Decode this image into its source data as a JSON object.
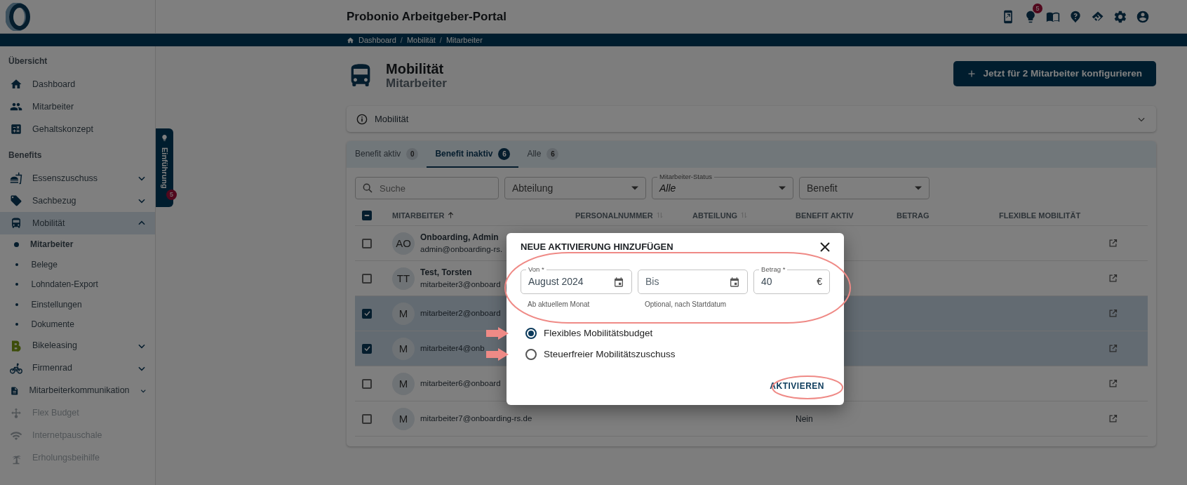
{
  "header": {
    "title": "Probonio Arbeitgeber-Portal",
    "notification_count": "5"
  },
  "breadcrumb": [
    {
      "kind": "link",
      "text": "Dashboard"
    },
    {
      "kind": "separator",
      "text": "/"
    },
    {
      "kind": "link",
      "text": "Mobilität"
    },
    {
      "kind": "separator",
      "text": "/"
    },
    {
      "kind": "link",
      "text": "Mitarbeiter"
    }
  ],
  "sidebar": {
    "sections": [
      {
        "title": "Übersicht",
        "items": [
          {
            "label": "Dashboard",
            "selected": false,
            "disabled": false
          },
          {
            "label": "Mitarbeiter",
            "selected": false,
            "disabled": false
          },
          {
            "label": "Gehaltskonzept",
            "selected": false,
            "disabled": false
          }
        ]
      },
      {
        "title": "Benefits",
        "items": [
          {
            "label": "Essenszuschuss",
            "selected": false,
            "disabled": false,
            "expanded": false
          },
          {
            "label": "Sachbezug",
            "selected": false,
            "disabled": false,
            "expanded": false
          },
          {
            "label": "Mobilität",
            "selected": true,
            "disabled": false,
            "expanded": true,
            "children": [
              {
                "label": "Mitarbeiter",
                "selected": true
              },
              {
                "label": "Belege",
                "selected": false
              },
              {
                "label": "Lohndaten-Export",
                "selected": false
              },
              {
                "label": "Einstellungen",
                "selected": false
              },
              {
                "label": "Dokumente",
                "selected": false
              }
            ]
          },
          {
            "label": "Bikeleasing",
            "selected": false,
            "disabled": false,
            "expanded": false
          },
          {
            "label": "Firmenrad",
            "selected": false,
            "disabled": false,
            "expanded": false
          },
          {
            "label": "Mitarbeiterkommunikation",
            "selected": false,
            "disabled": false,
            "expanded": false
          },
          {
            "label": "Flex Budget",
            "selected": false,
            "disabled": true
          },
          {
            "label": "Internetpauschale",
            "selected": false,
            "disabled": true
          },
          {
            "label": "Erholungsbeihilfe",
            "selected": false,
            "disabled": true
          }
        ]
      }
    ]
  },
  "intro_tab": {
    "label": "Einführung",
    "badge": "5"
  },
  "page": {
    "title": "Mobilität",
    "subtitle": "Mitarbeiter",
    "action_button": "Jetzt für 2 Mitarbeiter konfigurieren"
  },
  "accordion": {
    "title": "Mobilität",
    "expanded": false
  },
  "tabs": [
    {
      "label": "Benefit aktiv",
      "count": "0",
      "selected": false
    },
    {
      "label": "Benefit inaktiv",
      "count": "6",
      "selected": true
    },
    {
      "label": "Alle",
      "count": "6",
      "selected": false
    }
  ],
  "filters": [
    {
      "kind": "search",
      "placeholder": "Suche"
    },
    {
      "kind": "select",
      "placeholder": "Abteilung"
    },
    {
      "kind": "select",
      "label": "Mitarbeiter-Status",
      "value": "Alle"
    },
    {
      "kind": "select",
      "placeholder": "Benefit"
    }
  ],
  "table": {
    "header_checkbox": {
      "indeterminate": true
    },
    "columns": [
      {
        "label": "MITARBEITER",
        "sortable": true,
        "sorted": true
      },
      {
        "label": "PERSONALNUMMER",
        "sortable": true,
        "sorted": false
      },
      {
        "label": "ABTEILUNG",
        "sortable": true,
        "sorted": false
      },
      {
        "label": "BENEFIT AKTIV"
      },
      {
        "label": "BETRAG"
      },
      {
        "label": "FLEXIBLE MOBILITÄT"
      }
    ],
    "rows": [
      {
        "selected": false,
        "initials": "AO",
        "name": "Onboarding, Admin",
        "email": "admin@onboarding-rs."
      },
      {
        "selected": false,
        "initials": "TT",
        "name": "Test, Torsten",
        "email": "mitarbeiter3@onboard"
      },
      {
        "selected": true,
        "initials": "M",
        "email": "mitarbeiter2@onboard"
      },
      {
        "selected": true,
        "initials": "M",
        "email": "mitarbeiter4@onb"
      },
      {
        "selected": false,
        "initials": "M",
        "email": "mitarbeiter6@onboard"
      },
      {
        "selected": false,
        "initials": "M",
        "email": "mitarbeiter7@onboarding-rs.de",
        "benefit_active": "Nein"
      }
    ]
  },
  "dialog": {
    "title": "NEUE AKTIVIERUNG HINZUFÜGEN",
    "fields": [
      {
        "kind": "date",
        "label": "Von *",
        "value": "August 2024",
        "helper": "Ab aktuellem Monat"
      },
      {
        "kind": "date",
        "placeholder": "Bis",
        "helper": "Optional, nach Startdatum"
      },
      {
        "kind": "amount",
        "label": "Betrag *",
        "value": "40",
        "suffix": "€"
      }
    ],
    "options": [
      {
        "label": "Flexibles Mobilitätsbudget",
        "selected": true
      },
      {
        "label": "Steuerfreier Mobilitätszuschuss",
        "selected": false
      }
    ],
    "button": "AKTIVIEREN"
  }
}
